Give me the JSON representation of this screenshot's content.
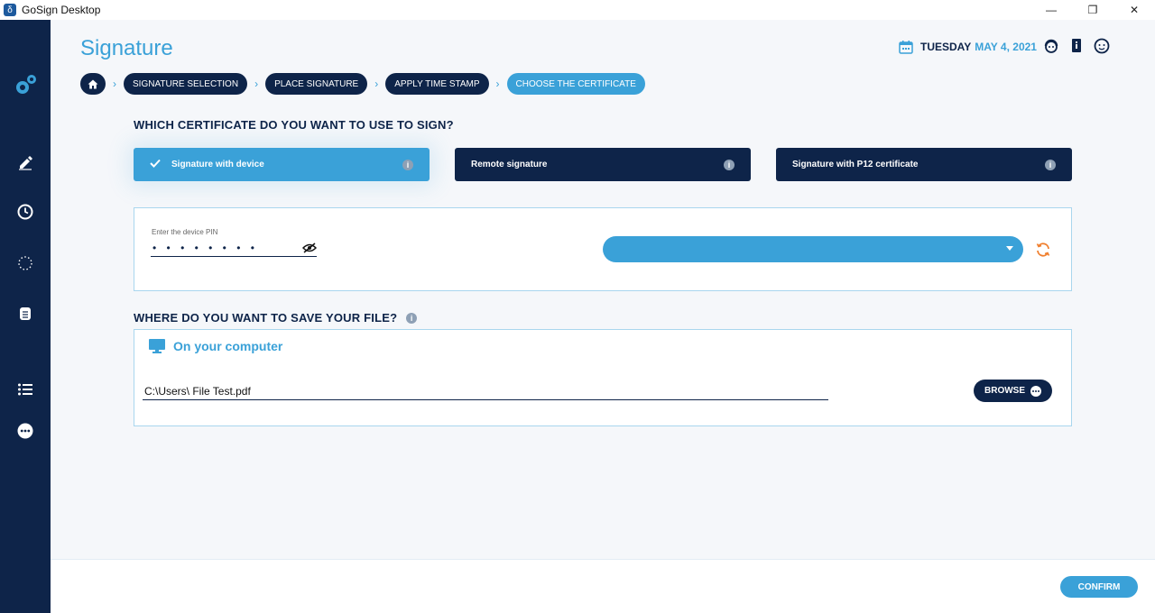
{
  "window": {
    "title": "GoSign Desktop",
    "minimize": "—",
    "restore": "❐",
    "close": "✕"
  },
  "header": {
    "page_title": "Signature",
    "date_day": "TUESDAY",
    "date_rest": "MAY 4, 2021"
  },
  "breadcrumb": {
    "steps": [
      "SIGNATURE SELECTION",
      "PLACE SIGNATURE",
      "APPLY TIME STAMP",
      "CHOOSE THE CERTIFICATE"
    ]
  },
  "certificate": {
    "question": "WHICH CERTIFICATE DO YOU WANT TO USE TO SIGN?",
    "options": [
      {
        "label": "Signature with device",
        "selected": true
      },
      {
        "label": "Remote signature",
        "selected": false
      },
      {
        "label": "Signature with P12 certificate",
        "selected": false
      }
    ]
  },
  "pin": {
    "label": "Enter the device PIN",
    "value": "• • • • • • • •"
  },
  "save": {
    "question": "WHERE DO YOU WANT TO SAVE YOUR FILE?",
    "location_title": "On your computer",
    "path": "C:\\Users\\  File Test.pdf",
    "browse_label": "BROWSE"
  },
  "footer": {
    "confirm_label": "CONFIRM"
  },
  "colors": {
    "navy": "#0e2449",
    "accent": "#3aa1d8",
    "refresh": "#f07f2e"
  }
}
